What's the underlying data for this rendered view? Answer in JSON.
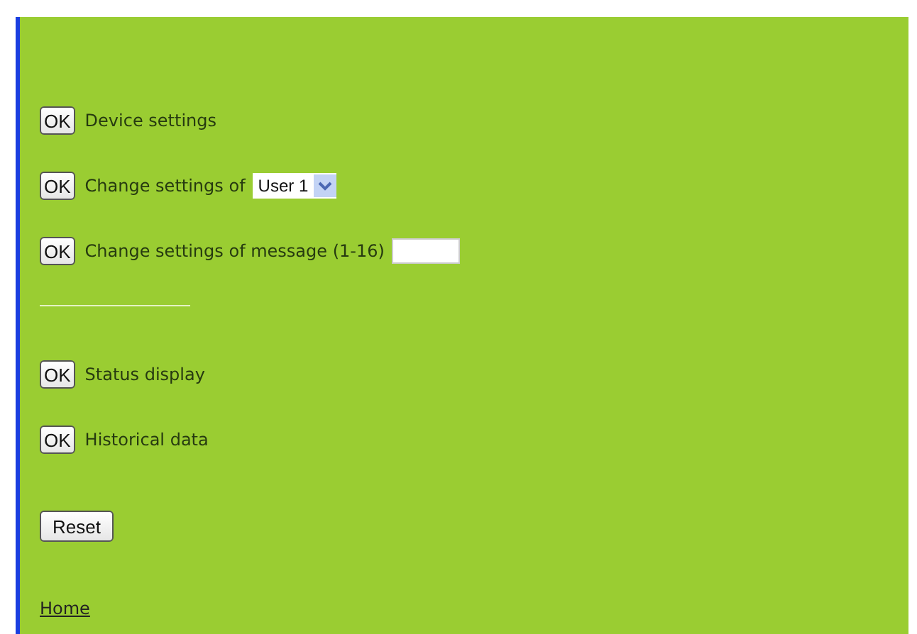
{
  "settings_actions": [
    {
      "kind": "plain",
      "button": "OK",
      "label": "Device settings"
    },
    {
      "kind": "select",
      "button": "OK",
      "label": "Change settings of",
      "value": "User 1"
    },
    {
      "kind": "input",
      "button": "OK",
      "label": "Change settings of message (1-16)"
    }
  ],
  "view_actions": [
    {
      "button": "OK",
      "label": "Status display"
    },
    {
      "button": "OK",
      "label": "Historical data"
    }
  ],
  "reset_button": "Reset",
  "home_link": "Home"
}
